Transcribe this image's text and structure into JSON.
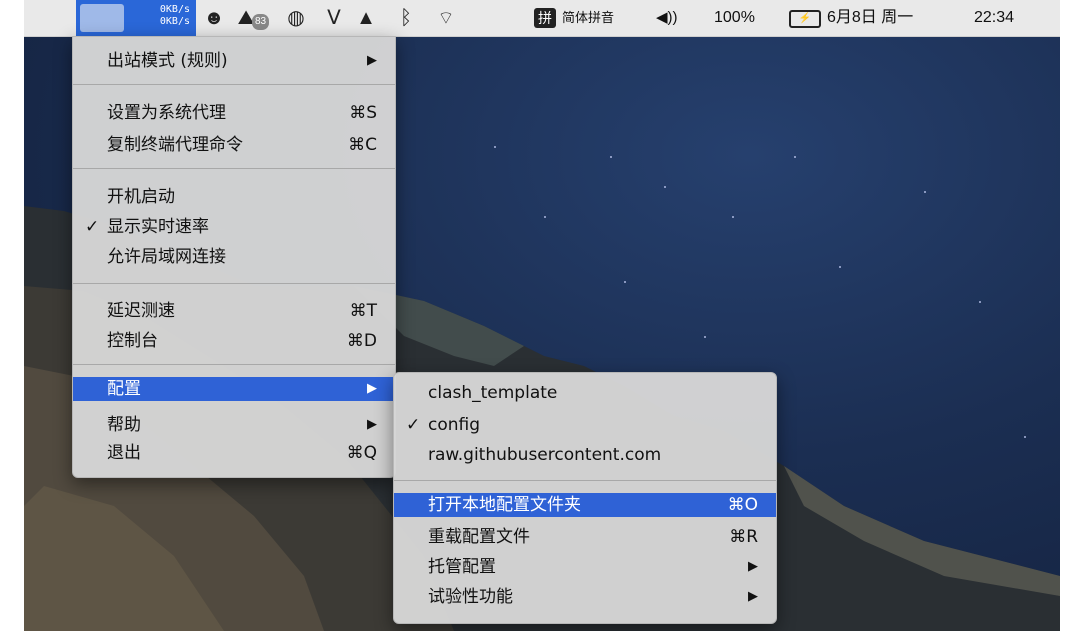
{
  "menubar": {
    "speed_up": "0KB/s",
    "speed_down": "0KB/s",
    "icon_badge": "83",
    "ime_char": "拼",
    "ime_label": "简体拼音",
    "volume": "◀))",
    "battery_percent": "100%",
    "date": "6月8日 周一",
    "time": "22:34"
  },
  "main_menu": {
    "items": [
      {
        "label": "出站模式 (规则)",
        "shortcut": "",
        "submenu": true,
        "checked": false
      },
      {
        "label": "设置为系统代理",
        "shortcut": "⌘S",
        "submenu": false,
        "checked": false
      },
      {
        "label": "复制终端代理命令",
        "shortcut": "⌘C",
        "submenu": false,
        "checked": false
      },
      {
        "label": "开机启动",
        "shortcut": "",
        "submenu": false,
        "checked": false
      },
      {
        "label": "显示实时速率",
        "shortcut": "",
        "submenu": false,
        "checked": true
      },
      {
        "label": "允许局域网连接",
        "shortcut": "",
        "submenu": false,
        "checked": false
      },
      {
        "label": "延迟测速",
        "shortcut": "⌘T",
        "submenu": false,
        "checked": false
      },
      {
        "label": "控制台",
        "shortcut": "⌘D",
        "submenu": false,
        "checked": false
      },
      {
        "label": "配置",
        "shortcut": "",
        "submenu": true,
        "checked": false,
        "highlighted": true
      },
      {
        "label": "帮助",
        "shortcut": "",
        "submenu": true,
        "checked": false
      },
      {
        "label": "退出",
        "shortcut": "⌘Q",
        "submenu": false,
        "checked": false
      }
    ]
  },
  "config_submenu": {
    "items": [
      {
        "label": "clash_template",
        "shortcut": "",
        "submenu": false,
        "checked": false
      },
      {
        "label": "config",
        "shortcut": "",
        "submenu": false,
        "checked": true
      },
      {
        "label": "raw.githubusercontent.com",
        "shortcut": "",
        "submenu": false,
        "checked": false
      },
      {
        "label": "打开本地配置文件夹",
        "shortcut": "⌘O",
        "submenu": false,
        "checked": false,
        "highlighted": true
      },
      {
        "label": "重载配置文件",
        "shortcut": "⌘R",
        "submenu": false,
        "checked": false
      },
      {
        "label": "托管配置",
        "shortcut": "",
        "submenu": true,
        "checked": false
      },
      {
        "label": "试验性功能",
        "shortcut": "",
        "submenu": true,
        "checked": false
      }
    ]
  },
  "glyphs": {
    "check": "✓",
    "arrow": "▶"
  },
  "colors": {
    "highlight": "#2f62d6",
    "menu_bg": "#d6d6d6",
    "speed_bg": "#2a67d8"
  }
}
